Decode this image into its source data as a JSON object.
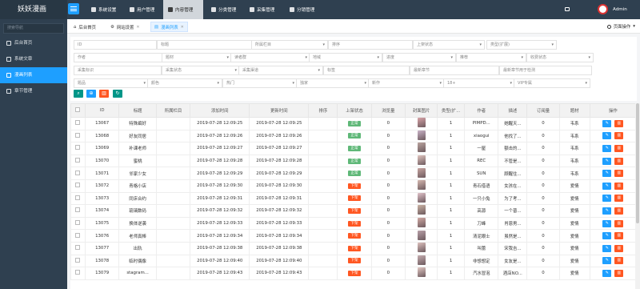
{
  "app": {
    "title": "妖妖漫画"
  },
  "header": {
    "nav": [
      {
        "label": "系统设置",
        "icon": "gear-icon"
      },
      {
        "label": "用户管理",
        "icon": "user-icon"
      },
      {
        "label": "内容管理",
        "icon": "document-icon",
        "active": true
      },
      {
        "label": "分类管理",
        "icon": "grid-icon"
      },
      {
        "label": "采集管理",
        "icon": "cloud-icon"
      },
      {
        "label": "分销管理",
        "icon": "share-icon"
      }
    ],
    "admin": "Admin"
  },
  "sidebar": {
    "search_placeholder": "搜索导航",
    "items": [
      {
        "label": "后台首页",
        "icon": "home-icon"
      },
      {
        "label": "系统文章",
        "icon": "article-icon"
      },
      {
        "label": "漫画列表",
        "icon": "list-icon",
        "active": true
      },
      {
        "label": "章节管理",
        "icon": "chapter-icon"
      }
    ]
  },
  "tabs": [
    {
      "label": "后台首页",
      "closable": false
    },
    {
      "label": "网站设置",
      "closable": true
    },
    {
      "label": "漫画列表",
      "closable": true,
      "active": true
    }
  ],
  "page_op": "页面操作",
  "filters": {
    "row1": [
      "ID",
      "标题",
      "所属栏目",
      "排序",
      "上架状态",
      "类型(扩展)"
    ],
    "row2": [
      "作者",
      "题材",
      "读者群",
      "地域",
      "进度",
      "推荐",
      "收费状态"
    ],
    "row3": [
      "采集标识",
      "采集状态",
      "采集渠道",
      "标签",
      "最新章节",
      "最新章节用于检测"
    ],
    "row4": [
      "题品",
      "颜色",
      "热门",
      "独家",
      "新作",
      "18+",
      "VIP专属"
    ]
  },
  "table": {
    "headers": [
      "",
      "ID",
      "标题",
      "所属栏目",
      "添加时间",
      "更新时间",
      "排序",
      "上架状态",
      "浏览量",
      "封面图片",
      "类型(扩...",
      "作者",
      "描述",
      "订阅量",
      "题材",
      "操作"
    ],
    "rows": [
      {
        "id": "13067",
        "title": "特殊癖好",
        "added": "2019-07-28 12:09:25",
        "updated": "2019-07-28 12:09:25",
        "status": "正常",
        "views": "0",
        "type": "1",
        "author": "PIMPD...",
        "desc": "她醒天...",
        "subs": "0",
        "genre": "韦系"
      },
      {
        "id": "13068",
        "title": "好友同居",
        "added": "2019-07-28 12:09:26",
        "updated": "2019-07-28 12:09:26",
        "status": "正常",
        "views": "0",
        "type": "1",
        "author": "xiaogui",
        "desc": "他找了...",
        "subs": "0",
        "genre": "韦系"
      },
      {
        "id": "13069",
        "title": "补课老师",
        "added": "2019-07-28 12:09:27",
        "updated": "2019-07-28 12:09:27",
        "status": "正常",
        "views": "0",
        "type": "1",
        "author": "一屋",
        "desc": "额击的...",
        "subs": "0",
        "genre": "韦系"
      },
      {
        "id": "13070",
        "title": "蜜桃",
        "added": "2019-07-28 12:09:28",
        "updated": "2019-07-28 12:09:28",
        "status": "正常",
        "views": "0",
        "type": "1",
        "author": "REC",
        "desc": "不管是...",
        "subs": "0",
        "genre": "韦系"
      },
      {
        "id": "13071",
        "title": "邻家少女",
        "added": "2019-07-28 12:09:29",
        "updated": "2019-07-28 12:09:29",
        "status": "正常",
        "views": "0",
        "type": "1",
        "author": "SUN",
        "desc": "顾醒住...",
        "subs": "0",
        "genre": "韦系"
      },
      {
        "id": "13072",
        "title": "青格小店",
        "added": "2019-07-28 12:09:30",
        "updated": "2019-07-28 12:09:30",
        "status": "下架",
        "views": "0",
        "type": "1",
        "author": "青石借语",
        "desc": "女孩在...",
        "subs": "0",
        "genre": "爱情"
      },
      {
        "id": "13073",
        "title": "同床合约",
        "added": "2019-07-28 12:09:31",
        "updated": "2019-07-28 12:09:31",
        "status": "下架",
        "views": "0",
        "type": "1",
        "author": "一只小兔",
        "desc": "为了考...",
        "subs": "0",
        "genre": "爱情"
      },
      {
        "id": "13074",
        "title": "琉璃数码",
        "added": "2019-07-28 12:09:32",
        "updated": "2019-07-28 12:09:32",
        "status": "下架",
        "views": "0",
        "type": "1",
        "author": "高源",
        "desc": "一个普...",
        "subs": "0",
        "genre": "爱情"
      },
      {
        "id": "13075",
        "title": "换体逆袭",
        "added": "2019-07-28 12:09:33",
        "updated": "2019-07-28 12:09:33",
        "status": "下架",
        "views": "0",
        "type": "1",
        "author": "刀峰",
        "desc": "肖恩男...",
        "subs": "0",
        "genre": "爱情"
      },
      {
        "id": "13076",
        "title": "老师真棒",
        "added": "2019-07-28 12:09:34",
        "updated": "2019-07-28 12:09:34",
        "status": "下架",
        "views": "0",
        "type": "1",
        "author": "清泥眼士",
        "desc": "虽然是...",
        "subs": "0",
        "genre": "爱情"
      },
      {
        "id": "13077",
        "title": "出轨",
        "added": "2019-07-28 12:09:38",
        "updated": "2019-07-28 12:09:38",
        "status": "下架",
        "views": "0",
        "type": "1",
        "author": "叫蕾",
        "desc": "宋我吉...",
        "subs": "0",
        "genre": "爱情"
      },
      {
        "id": "13078",
        "title": "临时偶像",
        "added": "2019-07-28 12:09:40",
        "updated": "2019-07-28 12:09:40",
        "status": "下架",
        "views": "0",
        "type": "1",
        "author": "非想想定",
        "desc": "女友是...",
        "subs": "0",
        "genre": "爱情"
      },
      {
        "id": "13079",
        "title": "stagram...",
        "added": "2019-07-28 12:09:43",
        "updated": "2019-07-28 12:09:43",
        "status": "下架",
        "views": "0",
        "type": "1",
        "author": "汽水冒泡",
        "desc": "酒店NO...",
        "subs": "0",
        "genre": "爱情"
      }
    ]
  },
  "colors": {
    "topbar": "#2f4050",
    "accent": "#1e9fff",
    "status_on": "#5fb878",
    "status_off": "#ff5722",
    "search_btn": "#009688",
    "reset_btn": "#1e9fff",
    "delete_btn": "#ff5722",
    "refresh_btn": "#009688"
  }
}
